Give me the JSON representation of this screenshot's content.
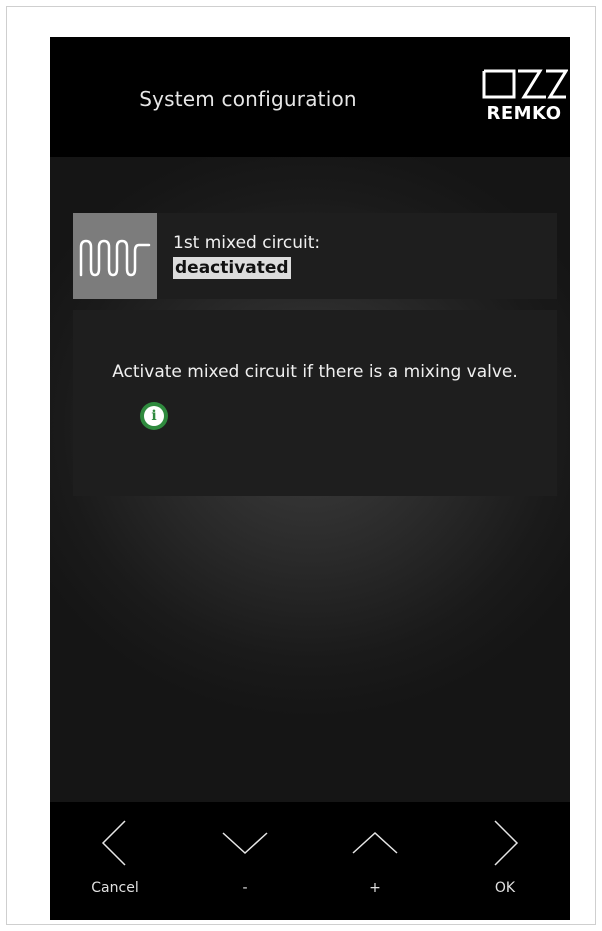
{
  "header": {
    "title": "System configuration",
    "logo_text": "REMKO"
  },
  "setting": {
    "icon": "mixed-circuit-icon",
    "label": "1st mixed circuit:",
    "value": "deactivated"
  },
  "info": {
    "text": "Activate mixed circuit if there is a mixing valve.",
    "icon": "info-icon",
    "icon_glyph": "i",
    "icon_color": "#2f8a3e"
  },
  "footer": {
    "buttons": [
      {
        "label": "Cancel",
        "icon": "chevron-left-icon"
      },
      {
        "label": "-",
        "icon": "chevron-down-icon"
      },
      {
        "label": "+",
        "icon": "chevron-up-icon"
      },
      {
        "label": "OK",
        "icon": "chevron-right-icon"
      }
    ]
  },
  "colors": {
    "header_bg": "#000000",
    "panel_bg": "#1e1e1e",
    "icon_tile_bg": "#7c7c7c",
    "value_highlight": "#dcdcdc"
  }
}
